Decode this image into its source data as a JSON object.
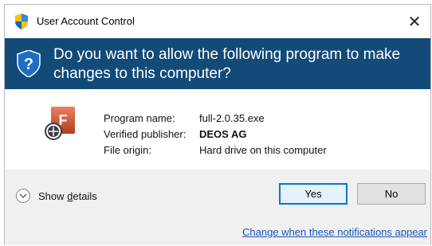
{
  "window": {
    "title": "User Account Control",
    "close_symbol": "✕"
  },
  "banner": {
    "question": "Do you want to allow the following program to make changes to this computer?",
    "icon": "shield-question-icon"
  },
  "program": {
    "icon": "program-icon",
    "icon_letter": "F",
    "fields": [
      {
        "label": "Program name:",
        "value": "full-2.0.35.exe",
        "bold": false
      },
      {
        "label": "Verified publisher:",
        "value": "DEOS AG",
        "bold": true
      },
      {
        "label": "File origin:",
        "value": "Hard drive on this computer",
        "bold": false
      }
    ]
  },
  "footer": {
    "show_details_label": "Show details",
    "show_details_mnemonic": "d",
    "yes_label": "Yes",
    "no_label": "No",
    "notifications_link": "Change when these notifications appear"
  },
  "colors": {
    "banner": "#124a78",
    "accent": "#0078d7",
    "link": "#1a56b7",
    "footer": "#f0f0f0"
  }
}
